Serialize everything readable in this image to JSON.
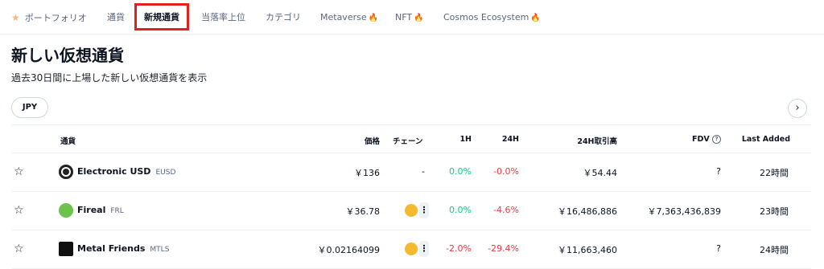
{
  "tabs": [
    {
      "label": "ポートフォリオ"
    },
    {
      "label": "通貨"
    },
    {
      "label": "新規通貨"
    },
    {
      "label": "当落率上位"
    },
    {
      "label": "カテゴリ"
    },
    {
      "label": "Metaverse"
    },
    {
      "label": "NFT"
    },
    {
      "label": "Cosmos Ecosystem"
    }
  ],
  "page": {
    "title": "新しい仮想通貨",
    "subtitle": "過去30日間に上場した新しい仮想通貨を表示",
    "currency_button": "JPY"
  },
  "table": {
    "headers": {
      "coin": "通貨",
      "price": "価格",
      "chain": "チェーン",
      "h1": "1H",
      "h24": "24H",
      "volume": "24H取引高",
      "fdv": "FDV",
      "added": "Last Added"
    },
    "rows": [
      {
        "name": "Electronic USD",
        "symbol": "EUSD",
        "price": "￥136",
        "chain": "-",
        "h1": "0.0%",
        "h24": "-0.0%",
        "volume": "￥54.44",
        "fdv": "?",
        "added": "22時間",
        "logo_color": "#222222"
      },
      {
        "name": "Fireal",
        "symbol": "FRL",
        "price": "￥36.78",
        "chain": "",
        "h1": "0.0%",
        "h24": "-4.6%",
        "volume": "￥16,486,886",
        "fdv": "￥7,363,436,839",
        "added": "23時間",
        "logo_color": "#6cc24a"
      },
      {
        "name": "Metal Friends",
        "symbol": "MTLS",
        "price": "￥0.02164099",
        "chain": "",
        "h1": "-2.0%",
        "h24": "-29.4%",
        "volume": "￥11,663,460",
        "fdv": "?",
        "added": "24時間",
        "logo_color": "#111111"
      }
    ]
  },
  "colors": {
    "positive": "#16c784",
    "negative": "#ea3943",
    "highlight_border": "#e3201b"
  }
}
